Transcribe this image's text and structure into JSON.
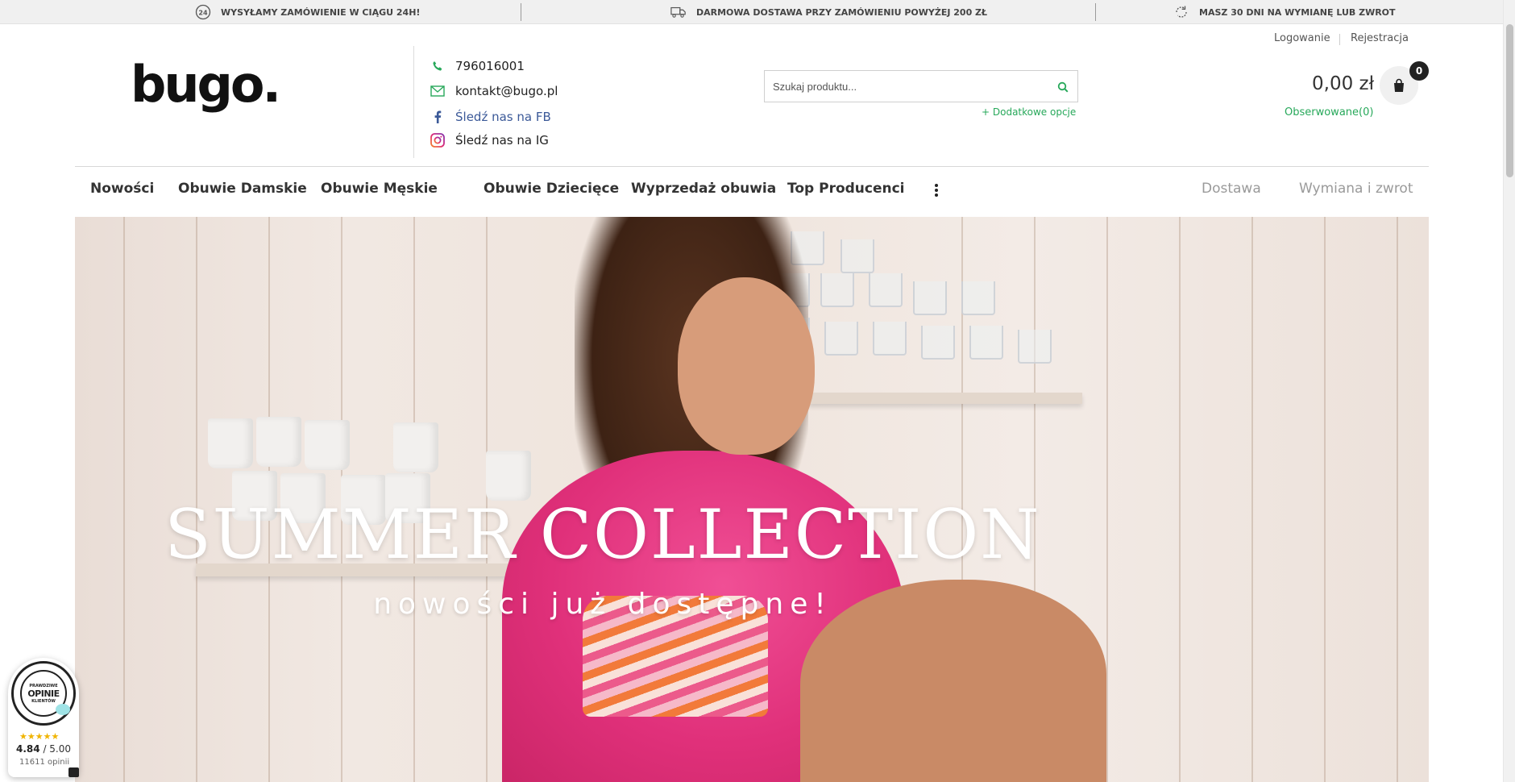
{
  "topbar": {
    "info1": "WYSYŁAMY ZAMÓWIENIE W CIĄGU 24H!",
    "info2": "DARMOWA DOSTAWA PRZY ZAMÓWIENIU POWYŻEJ 200 ZŁ",
    "info3": "MASZ 30 DNI NA WYMIANĘ LUB ZWROT",
    "info1_icon": "24h-clock-icon",
    "info2_icon": "delivery-truck-icon",
    "info3_icon": "return-arrows-icon"
  },
  "header": {
    "logo": "bugo.",
    "contacts": {
      "phone": "796016001",
      "email": "kontakt@bugo.pl",
      "facebook": "Śledź nas na FB",
      "instagram": "Śledź nas na IG"
    },
    "search": {
      "placeholder": "Szukaj produktu...",
      "extra_options": "+ Dodatkowe opcje"
    },
    "account": {
      "login": "Logowanie",
      "register": "Rejestracja"
    },
    "cart": {
      "price": "0,00 zł",
      "count": "0"
    },
    "watched": "Obserwowane(0)"
  },
  "nav": {
    "items": [
      "Nowości",
      "Obuwie Damskie",
      "Obuwie Męskie",
      "Obuwie Dziecięce",
      "Wyprzedaż obuwia",
      "Top Producenci"
    ],
    "right": [
      "Dostawa",
      "Wymiana i zwrot"
    ]
  },
  "hero": {
    "title": "SUMMER COLLECTION",
    "subtitle": "nowości już dostępne!"
  },
  "widget": {
    "seal_top": "PRAWDZIWE",
    "seal_main": "OPINIE",
    "seal_bottom": "KLIENTÓW",
    "stars": "★★★★★",
    "score": "4.84",
    "score_max": "/ 5.00",
    "count": "11611 opinii"
  },
  "colors": {
    "accent_green": "#27a85a",
    "facebook_blue": "#3b5998",
    "hero_pink": "#e0307a"
  }
}
